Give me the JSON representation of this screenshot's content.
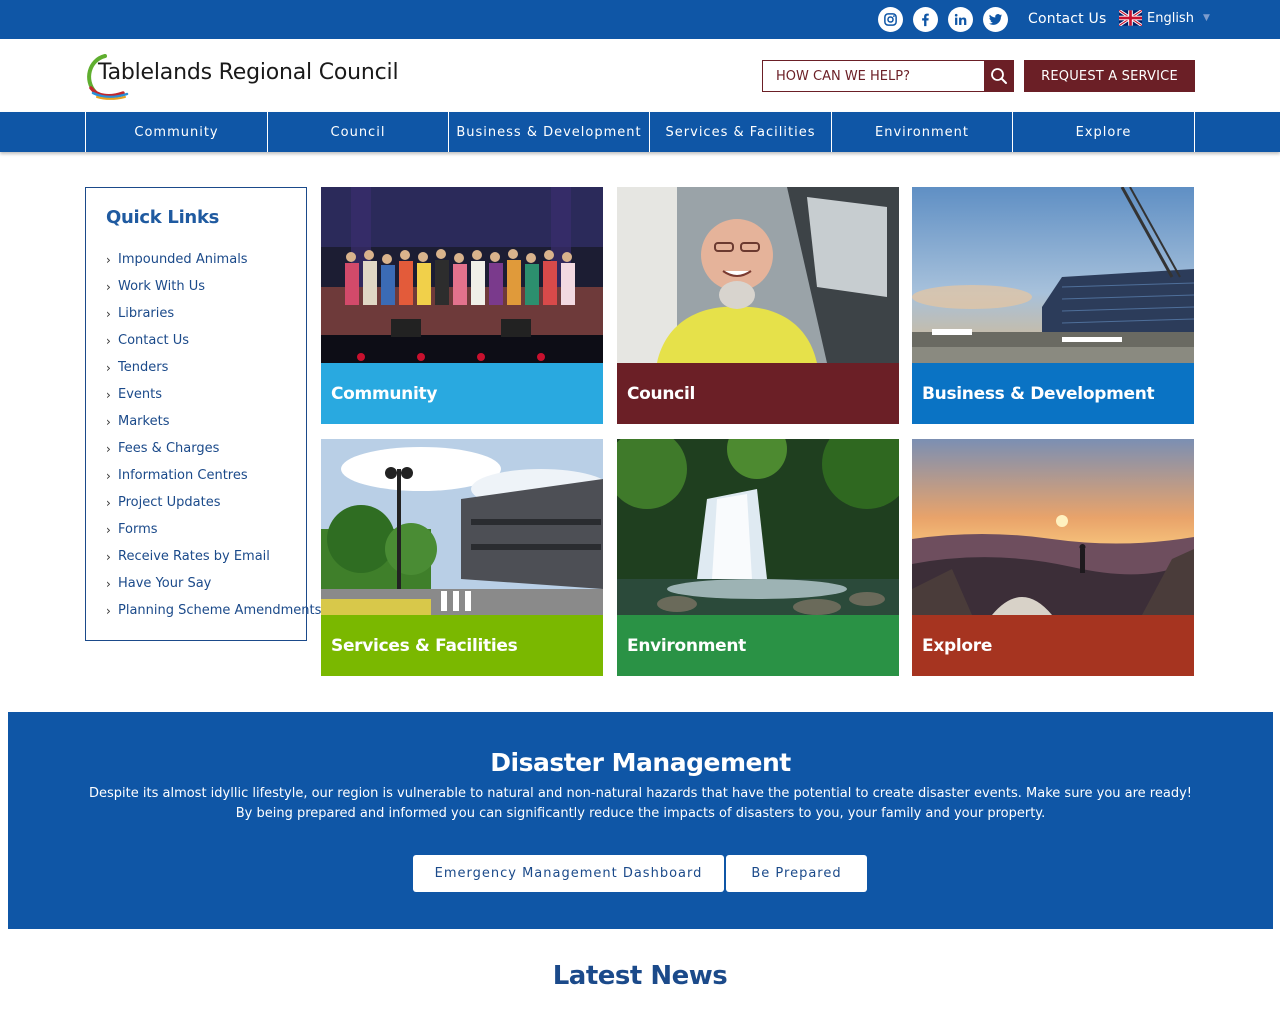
{
  "topbar": {
    "social": [
      {
        "name": "instagram-icon"
      },
      {
        "name": "facebook-icon"
      },
      {
        "name": "linkedin-icon"
      },
      {
        "name": "twitter-icon"
      }
    ],
    "contact_label": "Contact Us",
    "language": "English",
    "color": "#0f56a6"
  },
  "header": {
    "site_name": "Tablelands Regional Council",
    "search_placeholder": "HOW CAN WE HELP?",
    "request_label": "REQUEST A SERVICE",
    "accent": "#6b1f26"
  },
  "nav": {
    "items": [
      "Community",
      "Council",
      "Business & Development",
      "Services & Facilities",
      "Environment",
      "Explore"
    ]
  },
  "quick_links": {
    "title": "Quick Links",
    "items": [
      "Impounded Animals",
      "Work With Us",
      "Libraries",
      "Contact Us",
      "Tenders",
      "Events",
      "Markets",
      "Fees & Charges",
      "Information Centres",
      "Project Updates",
      "Forms",
      "Receive Rates by Email",
      "Have Your Say",
      "Planning Scheme Amendments"
    ]
  },
  "tiles": [
    {
      "label": "Community",
      "color": "#29a9e0"
    },
    {
      "label": "Council",
      "color": "#6b1f26"
    },
    {
      "label": "Business & Development",
      "color": "#0a73c4"
    },
    {
      "label": "Services & Facilities",
      "color": "#7ab800"
    },
    {
      "label": "Environment",
      "color": "#2a9245"
    },
    {
      "label": "Explore",
      "color": "#a63420"
    }
  ],
  "disaster": {
    "title": "Disaster Management",
    "line1": "Despite its almost idyllic lifestyle, our region is vulnerable to natural and non-natural hazards that have the potential to create disaster events. Make sure you are ready!",
    "line2": "By being prepared and informed you can significantly reduce the impacts of disasters to you, your family and your property.",
    "buttons": [
      "Emergency Management Dashboard",
      "Be Prepared"
    ]
  },
  "news": {
    "title": "Latest News"
  }
}
